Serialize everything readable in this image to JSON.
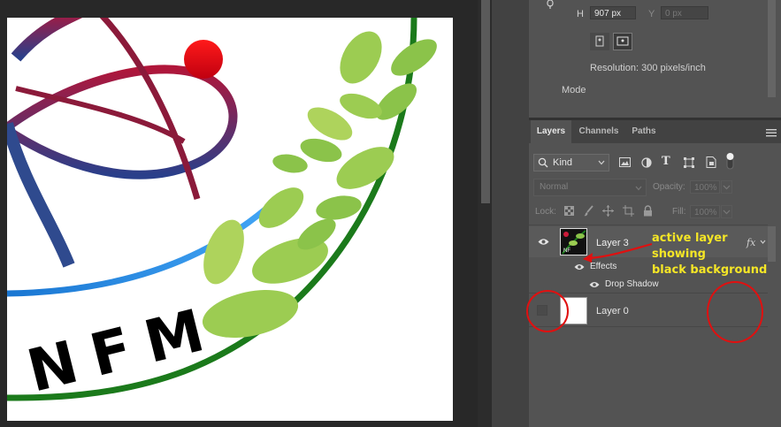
{
  "properties": {
    "h_label": "H",
    "h_value": "907 px",
    "y_label": "Y",
    "y_placeholder": "0 px",
    "resolution": "Resolution: 300 pixels/inch",
    "mode_label": "Mode"
  },
  "layers_panel": {
    "tabs": [
      "Layers",
      "Channels",
      "Paths"
    ],
    "filter_kind": "Kind",
    "blend_mode": "Normal",
    "opacity_label": "Opacity:",
    "opacity_value": "100%",
    "lock_label": "Lock:",
    "fill_label": "Fill:",
    "fill_value": "100%",
    "layers": [
      {
        "name": "Layer 3",
        "fx": "fx"
      },
      {
        "name": "Effects"
      },
      {
        "name": "Drop Shadow"
      },
      {
        "name": "Layer 0"
      }
    ]
  },
  "canvas": {
    "logo_text": "NFM"
  },
  "annotation": {
    "line1": "active layer showing",
    "line2": "black background"
  },
  "colors": {
    "panel_bg": "#535353",
    "canvas_bg": "#282828",
    "annotation_text": "#f5e626",
    "annotation_marks": "#e01010",
    "leaf_green": "#8bc34a",
    "arc_dark_green": "#1b7a1b",
    "arc_blue": "#1e88e5",
    "atom_crimson": "#9b1b3a"
  }
}
